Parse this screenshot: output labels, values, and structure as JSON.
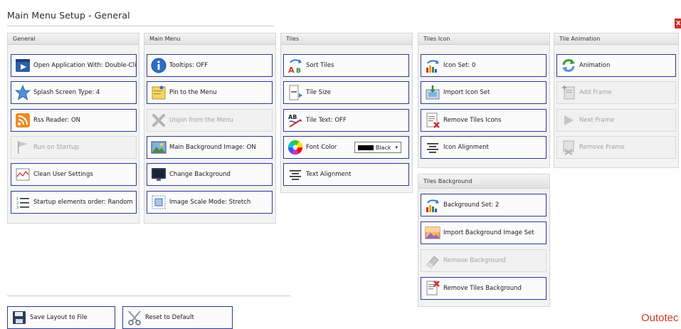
{
  "window": {
    "title": "Main Menu Setup - General",
    "close_label": "x"
  },
  "groups": {
    "general": {
      "header": "General",
      "buttons": [
        {
          "label": "Open Application With: Double-Click",
          "icon": "play-window-icon"
        },
        {
          "label": "Splash Screen Type: 4",
          "icon": "star-icon"
        },
        {
          "label": "Rss Reader: ON",
          "icon": "rss-icon"
        },
        {
          "label": "Run on Startup",
          "icon": "flag-icon",
          "disabled": true
        },
        {
          "label": "Clean User Settings",
          "icon": "clean-chart-icon"
        },
        {
          "label": "Startup elements order: Random",
          "icon": "numbered-list-icon"
        }
      ]
    },
    "main_menu": {
      "header": "Main Menu",
      "buttons": [
        {
          "label": "Tooltips: OFF",
          "icon": "info-icon"
        },
        {
          "label": "Pin to the Menu",
          "icon": "pin-note-icon"
        },
        {
          "label": "Unpin from the Menu",
          "icon": "x-icon",
          "disabled": true
        },
        {
          "label": "Main Background Image: ON",
          "icon": "image-icon"
        },
        {
          "label": "Change Background",
          "icon": "monitor-icon"
        },
        {
          "label": "Image Scale Mode: Stretch",
          "icon": "scale-icon"
        }
      ]
    },
    "tiles": {
      "header": "Tiles",
      "buttons": [
        {
          "label": "Sort Tiles",
          "icon": "sort-ab-icon"
        },
        {
          "label": "Tile Size",
          "icon": "tile-size-icon"
        },
        {
          "label": "Tile Text: OFF",
          "icon": "text-off-icon"
        },
        {
          "label": "Font Color",
          "icon": "color-wheel-icon"
        },
        {
          "label": "Text Alignment",
          "icon": "align-center-icon"
        }
      ],
      "font_color": {
        "value": "Black",
        "swatch": "#000000",
        "arrow": "▾"
      }
    },
    "tiles_icon": {
      "header": "Tiles Icon",
      "buttons": [
        {
          "label": "Icon Set: 0",
          "icon": "icon-set-icon"
        },
        {
          "label": "Import Icon Set",
          "icon": "import-icon"
        },
        {
          "label": "Remove Tiles Icons",
          "icon": "remove-doc-icon"
        },
        {
          "label": "Icon Alignment",
          "icon": "align-icon"
        }
      ]
    },
    "tiles_background": {
      "header": "Tiles Background",
      "buttons": [
        {
          "label": "Background Set: 2",
          "icon": "background-set-icon"
        },
        {
          "label": "Import Background Image Set",
          "icon": "landscape-icon"
        },
        {
          "label": "Remove Background",
          "icon": "eraser-icon",
          "disabled": true
        },
        {
          "label": "Remove Tiles Background",
          "icon": "remove-doc-icon"
        }
      ]
    },
    "tile_animation": {
      "header": "Tile Animation",
      "buttons": [
        {
          "label": "Animation",
          "icon": "refresh-icon"
        },
        {
          "label": "Add Frame",
          "icon": "add-frame-icon",
          "disabled": true
        },
        {
          "label": "Next Frame",
          "icon": "play-icon",
          "disabled": true
        },
        {
          "label": "Remove Frame",
          "icon": "remove-frame-icon",
          "disabled": true
        }
      ]
    }
  },
  "footer": {
    "save_label": "Save Layout to File",
    "reset_label": "Reset to Default"
  },
  "brand": "Outotec",
  "colors": {
    "button_border": "#2e3b8f",
    "brand": "#cf3a25",
    "close": "#c9362b"
  }
}
